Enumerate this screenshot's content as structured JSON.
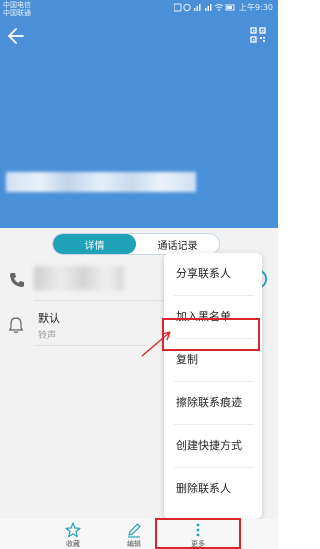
{
  "status_bar": {
    "carrier_1": "中国电信",
    "carrier_2": "中国联通",
    "icons": [
      "nfc-icon",
      "alarm-icon",
      "signal-icon",
      "signal-icon",
      "wifi-icon",
      "battery-icon"
    ],
    "time": "上午9:30"
  },
  "header": {
    "background_color": "#4a90d8",
    "back_icon": "back-arrow-icon",
    "qr_icon": "qr-code-icon"
  },
  "tabs": {
    "items": [
      {
        "label": "详情",
        "active": true
      },
      {
        "label": "通话记录",
        "active": false
      }
    ],
    "accent_color": "#1fa1b8"
  },
  "ringtone": {
    "value": "默认",
    "label": "铃声"
  },
  "menu": {
    "items": [
      {
        "label": "分享联系人"
      },
      {
        "label": "加入黑名单",
        "highlighted": true
      },
      {
        "label": "复制"
      },
      {
        "label": "擦除联系痕迹"
      },
      {
        "label": "创建快捷方式"
      },
      {
        "label": "删除联系人"
      }
    ]
  },
  "bottom_bar": {
    "buttons": [
      {
        "label": "收藏",
        "icon": "star-icon"
      },
      {
        "label": "编辑",
        "icon": "pencil-icon"
      },
      {
        "label": "更多",
        "icon": "more-vertical-icon",
        "highlighted": true
      }
    ]
  },
  "annotation_color": "#d9262c"
}
